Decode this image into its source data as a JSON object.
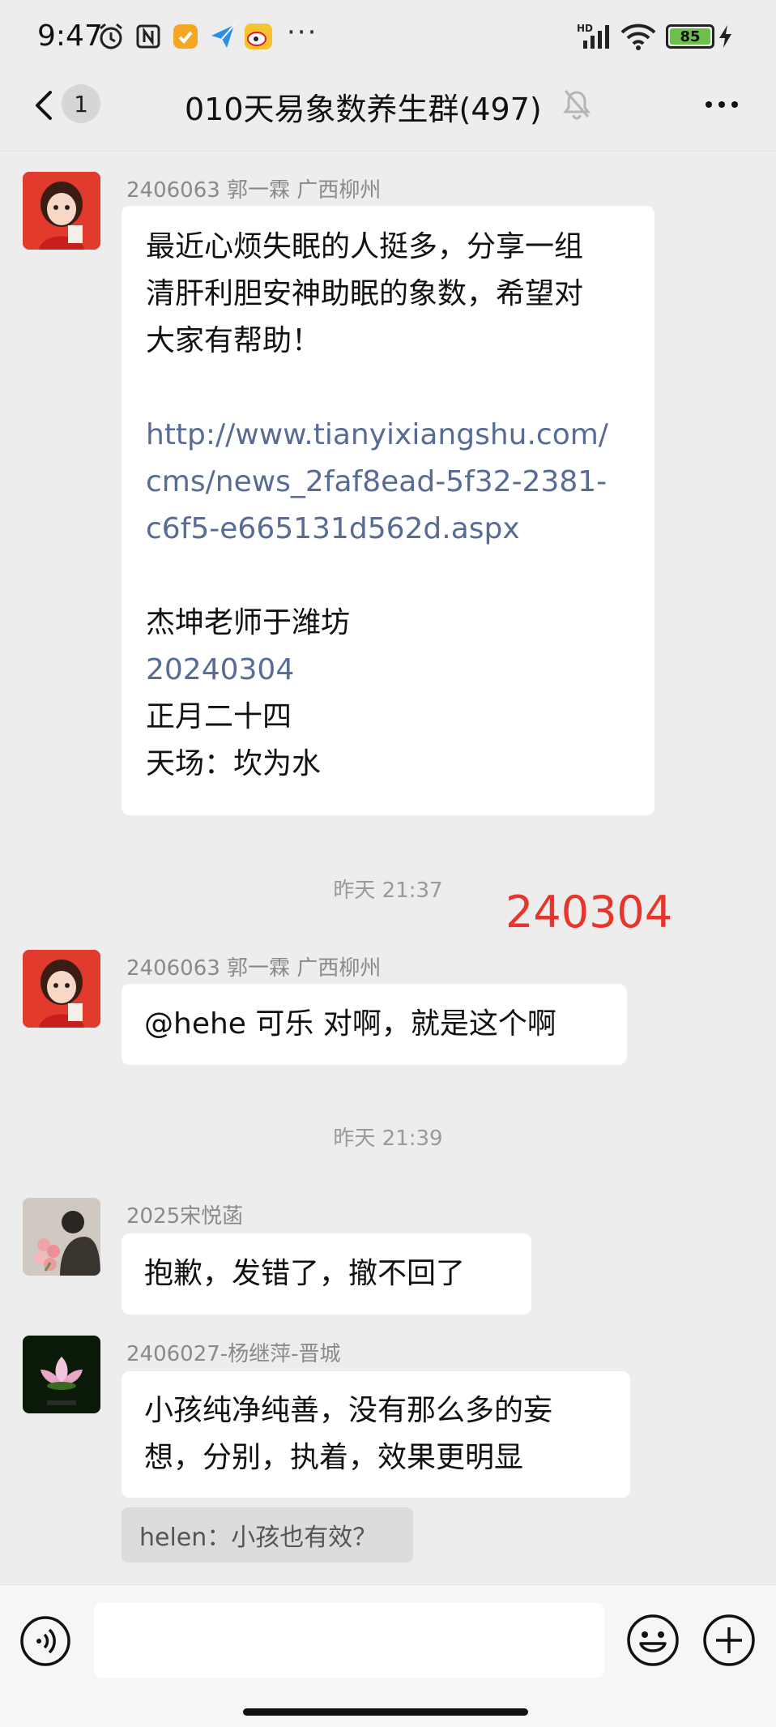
{
  "status_bar": {
    "time": "9:47",
    "network": "HD",
    "battery": "85",
    "more": "···"
  },
  "header": {
    "unread_count": "1",
    "title": "010天易象数养生群(497)"
  },
  "messages": [
    {
      "sender": "2406063 郭一霖  广西柳州",
      "lines": [
        "最近心烦失眠的人挺多，分享一组",
        "清肝利胆安神助眠的象数，希望对",
        "大家有帮助！"
      ],
      "link_lines": [
        "http://www.tianyixiangshu.com/",
        "cms/news_2faf8ead-5f32-2381-",
        "c6f5-e665131d562d.aspx"
      ],
      "signature": "杰坤老师于潍坊",
      "date_link": "20240304",
      "lunar": "正月二十四",
      "tianchang": "天场：坎为水"
    },
    {
      "sender": "2406063 郭一霖  广西柳州",
      "text": "@hehe 可乐  对啊，就是这个啊"
    },
    {
      "sender": "2025宋悦菡",
      "text": "抱歉，发错了，撤不回了"
    },
    {
      "sender": "2406027-杨继萍-晋城",
      "lines": [
        "小孩纯净纯善，没有那么多的妄",
        "想，分别，执着，效果更明显"
      ],
      "quote": "helen：小孩也有效？"
    }
  ],
  "timestamps": [
    "昨天 21:37",
    "昨天 21:39"
  ],
  "annotation": "240304",
  "colors": {
    "background": "#ededed",
    "link": "#576b95",
    "annotation": "#e8342a",
    "battery": "#6cc04a"
  }
}
